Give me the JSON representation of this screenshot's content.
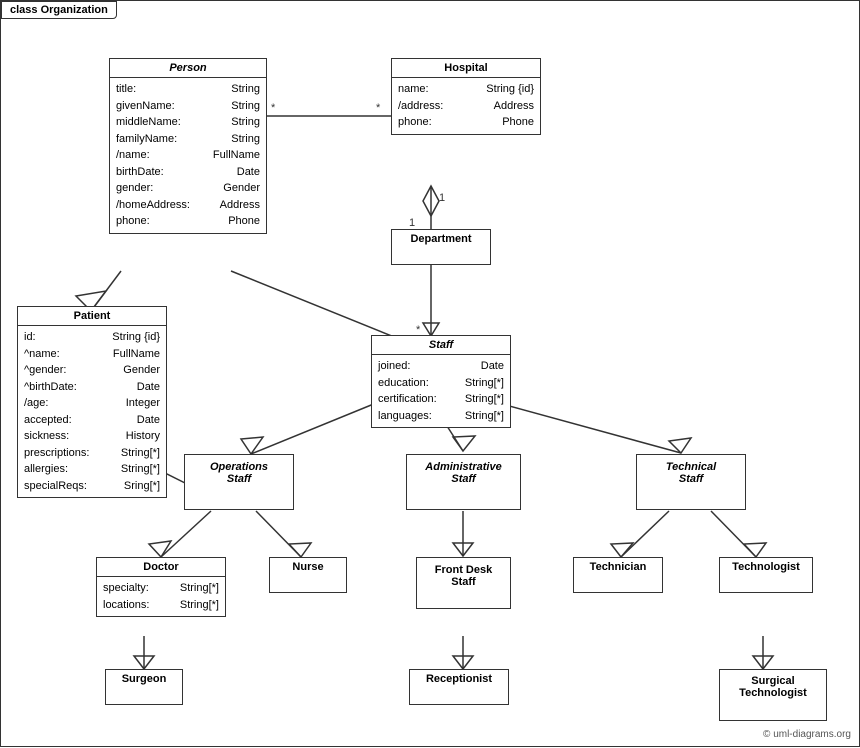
{
  "diagram": {
    "title": "class Organization",
    "classes": {
      "person": {
        "name": "Person",
        "italic": true,
        "attrs": [
          [
            "title:",
            "String"
          ],
          [
            "givenName:",
            "String"
          ],
          [
            "middleName:",
            "String"
          ],
          [
            "familyName:",
            "String"
          ],
          [
            "/name:",
            "FullName"
          ],
          [
            "birthDate:",
            "Date"
          ],
          [
            "gender:",
            "Gender"
          ],
          [
            "/homeAddress:",
            "Address"
          ],
          [
            "phone:",
            "Phone"
          ]
        ]
      },
      "hospital": {
        "name": "Hospital",
        "italic": false,
        "attrs": [
          [
            "name:",
            "String {id}"
          ],
          [
            "/address:",
            "Address"
          ],
          [
            "phone:",
            "Phone"
          ]
        ]
      },
      "department": {
        "name": "Department",
        "italic": false,
        "attrs": []
      },
      "staff": {
        "name": "Staff",
        "italic": true,
        "attrs": [
          [
            "joined:",
            "Date"
          ],
          [
            "education:",
            "String[*]"
          ],
          [
            "certification:",
            "String[*]"
          ],
          [
            "languages:",
            "String[*]"
          ]
        ]
      },
      "patient": {
        "name": "Patient",
        "italic": false,
        "attrs": [
          [
            "id:",
            "String {id}"
          ],
          [
            "^name:",
            "FullName"
          ],
          [
            "^gender:",
            "Gender"
          ],
          [
            "^birthDate:",
            "Date"
          ],
          [
            "/age:",
            "Integer"
          ],
          [
            "accepted:",
            "Date"
          ],
          [
            "sickness:",
            "History"
          ],
          [
            "prescriptions:",
            "String[*]"
          ],
          [
            "allergies:",
            "String[*]"
          ],
          [
            "specialReqs:",
            "Sring[*]"
          ]
        ]
      },
      "operations_staff": {
        "name": "Operations\nStaff",
        "italic": true,
        "attrs": []
      },
      "administrative_staff": {
        "name": "Administrative\nStaff",
        "italic": true,
        "attrs": []
      },
      "technical_staff": {
        "name": "Technical\nStaff",
        "italic": true,
        "attrs": []
      },
      "doctor": {
        "name": "Doctor",
        "italic": false,
        "attrs": [
          [
            "specialty:",
            "String[*]"
          ],
          [
            "locations:",
            "String[*]"
          ]
        ]
      },
      "nurse": {
        "name": "Nurse",
        "italic": false,
        "attrs": []
      },
      "front_desk_staff": {
        "name": "Front Desk\nStaff",
        "italic": false,
        "attrs": []
      },
      "technician": {
        "name": "Technician",
        "italic": false,
        "attrs": []
      },
      "technologist": {
        "name": "Technologist",
        "italic": false,
        "attrs": []
      },
      "surgeon": {
        "name": "Surgeon",
        "italic": false,
        "attrs": []
      },
      "receptionist": {
        "name": "Receptionist",
        "italic": false,
        "attrs": []
      },
      "surgical_technologist": {
        "name": "Surgical\nTechnologist",
        "italic": false,
        "attrs": []
      }
    },
    "copyright": "© uml-diagrams.org"
  }
}
